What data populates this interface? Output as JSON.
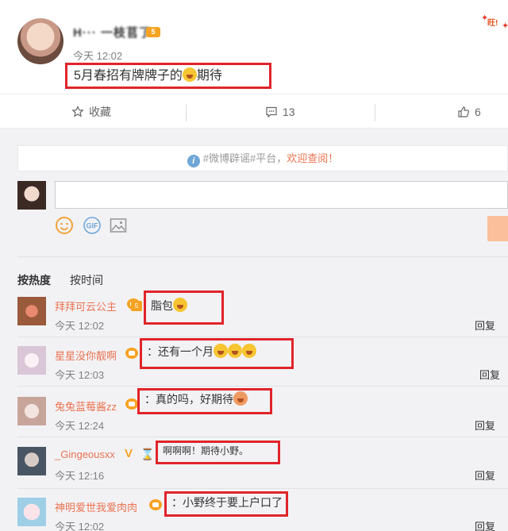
{
  "post": {
    "username": "H··· 一枝苢了",
    "vip_label": "5",
    "time": "今天 12:02",
    "content": "5月春招有牌牌子的",
    "content_tail": "期待",
    "corner_text": "旺!"
  },
  "actions": {
    "favorite": "收藏",
    "comments_count": "13",
    "likes_count": "6"
  },
  "notice": {
    "text_prefix": "#微博辟谣#平台，",
    "text_highlight": "欢迎查阅！"
  },
  "composer": {
    "input_value": "",
    "tools": [
      "emoji-icon",
      "gif-icon",
      "image-icon"
    ]
  },
  "sort": {
    "hot": "按热度",
    "time": "按时间"
  },
  "comments": [
    {
      "name": "拜拜可云公主",
      "text": "脂包",
      "time": "今天 12:02",
      "reply": "回复",
      "level": "5"
    },
    {
      "name": "星星没你靓啊",
      "text": "：还有一个月",
      "time": "今天 12:03",
      "reply": "回复"
    },
    {
      "name": "兔兔蓝莓酱zz",
      "text": "：真的吗，好期待",
      "time": "今天 12:24",
      "reply": "回复"
    },
    {
      "name": "_Gingeousxx",
      "text": "啊啊啊！期待小野。",
      "time": "今天 12:16",
      "reply": "回复"
    },
    {
      "name": "神明爱世我爱肉肉",
      "text": "：小野终于要上户口了",
      "time": "今天 12:02",
      "reply": "回复"
    }
  ],
  "colors": {
    "accent": "#eb7350",
    "highlight_box": "#e0242a",
    "vip": "#f6a323"
  }
}
